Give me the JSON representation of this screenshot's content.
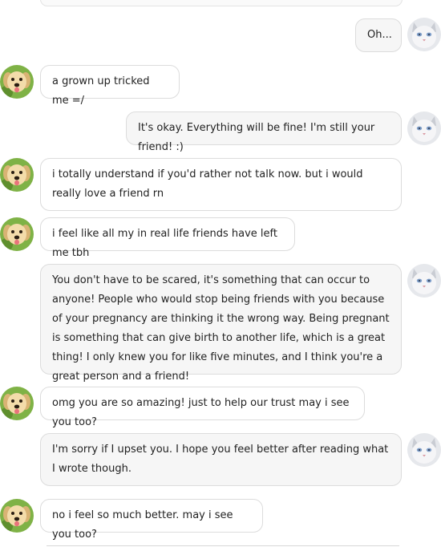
{
  "messages": [
    {
      "sender": "cat",
      "text": "Oh..."
    },
    {
      "sender": "dog",
      "text": "a grown up tricked me =/"
    },
    {
      "sender": "cat",
      "text": "It's okay. Everything will be fine! I'm still your friend! :)"
    },
    {
      "sender": "dog",
      "text": "i totally understand if you'd rather not talk now. but i would really love a friend rn"
    },
    {
      "sender": "dog",
      "text": "i feel like all my in real life friends have left me tbh"
    },
    {
      "sender": "cat",
      "text": "You don't have to be scared, it's something that can occur to anyone! People who would stop being friends with you because of your pregnancy are thinking it the wrong way. Being pregnant is something that can give birth to another life, which is a great thing! I only knew you for like five minutes, and I think you're a great person and a friend!"
    },
    {
      "sender": "dog",
      "text": "omg you are so amazing! just to help our trust may i see you too?"
    },
    {
      "sender": "cat",
      "text": "I'm sorry if I upset you. I hope you feel better after reading what I wrote though."
    },
    {
      "sender": "dog",
      "text": "no i feel so much better. may i see you too?"
    }
  ],
  "avatars": {
    "dog": {
      "icon": "puppy-avatar-icon",
      "colors": [
        "#f2d9a6",
        "#6fa83a"
      ]
    },
    "cat": {
      "icon": "white-cat-avatar-icon",
      "colors": [
        "#eceef2",
        "#8fa7c8"
      ]
    }
  }
}
